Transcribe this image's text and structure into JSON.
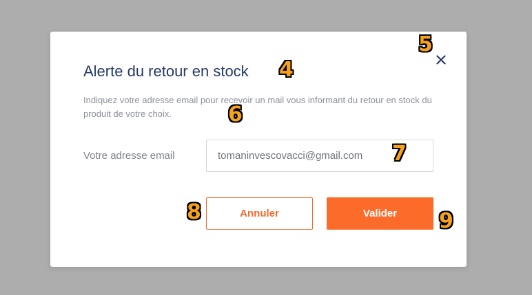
{
  "modal": {
    "title": "Alerte du retour en stock",
    "description": "Indiquez votre adresse email pour recevoir un mail vous informant du retour en stock du produit de votre choix.",
    "email_label": "Votre adresse email",
    "email_value": "tomaninvescovacci@gmail.com",
    "cancel_label": "Annuler",
    "validate_label": "Valider",
    "close_icon": "close-icon"
  },
  "annotations": {
    "m4": "4",
    "m5": "5",
    "m6": "6",
    "m7": "7",
    "m8": "8",
    "m9": "9"
  },
  "colors": {
    "overlay": "#adadad",
    "title": "#263a66",
    "accent": "#fd6b2b",
    "text_muted": "#8a8f99",
    "marker": "#f7a21b"
  }
}
